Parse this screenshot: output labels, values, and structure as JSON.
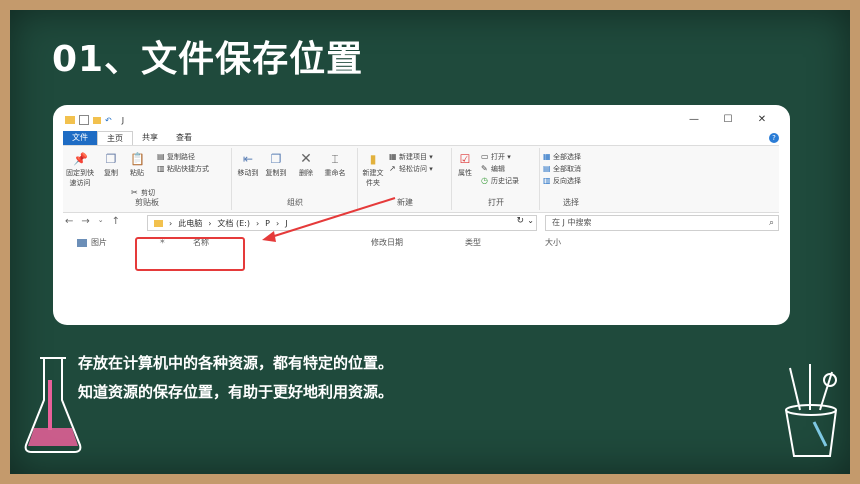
{
  "slide": {
    "title": "01、文件保存位置",
    "lines": [
      "存放在计算机中的各种资源，都有特定的位置。",
      "知道资源的保存位置，有助于更好地利用资源。"
    ]
  },
  "explorer": {
    "window_title": "J",
    "window_controls": [
      "—",
      "☐",
      "✕"
    ],
    "tabs": [
      "文件",
      "主页",
      "共享",
      "查看"
    ],
    "groups": {
      "clipboard": {
        "label": "剪贴板",
        "pin": "固定到快速访问",
        "copy": "复制",
        "paste": "粘贴",
        "copy_path": "复制路径",
        "paste_shortcut": "粘贴快捷方式",
        "cut": "剪切"
      },
      "organize": {
        "label": "组织",
        "move_to": "移动到",
        "copy_to": "复制到",
        "delete": "删除",
        "rename": "重命名"
      },
      "new": {
        "label": "新建",
        "new_folder": "新建文件夹",
        "new_item": "新建项目",
        "easy_access": "轻松访问"
      },
      "open": {
        "label": "打开",
        "properties": "属性",
        "open": "打开",
        "edit": "编辑",
        "history": "历史记录"
      },
      "select": {
        "label": "选择",
        "select_all": "全部选择",
        "select_none": "全部取消",
        "invert": "反向选择"
      }
    },
    "address": {
      "segments": [
        "此电脑",
        "文档 (E:)",
        "P",
        "J"
      ],
      "search_placeholder": "在 J 中搜索"
    },
    "columns": [
      "名称",
      "修改日期",
      "类型",
      "大小"
    ],
    "nav_item": "图片"
  },
  "colors": {
    "board": "#1f4a3c",
    "frame": "#c49a6c",
    "accent_red": "#e53a3a",
    "file_tab": "#1e6cc4"
  }
}
